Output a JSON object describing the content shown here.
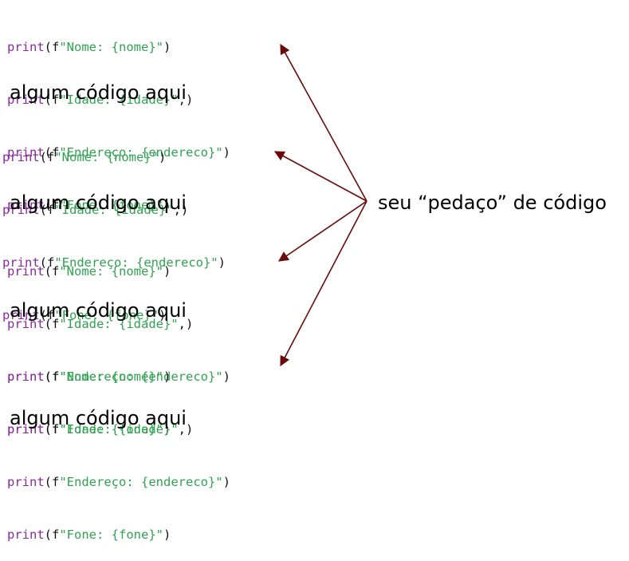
{
  "snippet": {
    "lines": [
      {
        "kw": "print",
        "open": "(f",
        "str": "\"Nome: {nome}\"",
        "close": ")"
      },
      {
        "kw": "print",
        "open": "(f",
        "str": "\"Idade: {idade}\"",
        "close": ",)"
      },
      {
        "kw": "print",
        "open": "(f",
        "str": "\"Endereço: {endereco}\"",
        "close": ")"
      },
      {
        "kw": "print",
        "open": "(f",
        "str": "\"Fone: {fone}\"",
        "close": ")"
      }
    ]
  },
  "blocks": [
    {
      "caption": "algum código aqui"
    },
    {
      "caption": "algum código aqui"
    },
    {
      "caption": "algum código aqui"
    },
    {
      "caption": "algum código aqui"
    }
  ],
  "callout": {
    "label": "seu “pedaço” de código"
  },
  "colors": {
    "keyword": "#8a2a9e",
    "string": "#2ea44f",
    "arrow": "#6b0a0a"
  }
}
